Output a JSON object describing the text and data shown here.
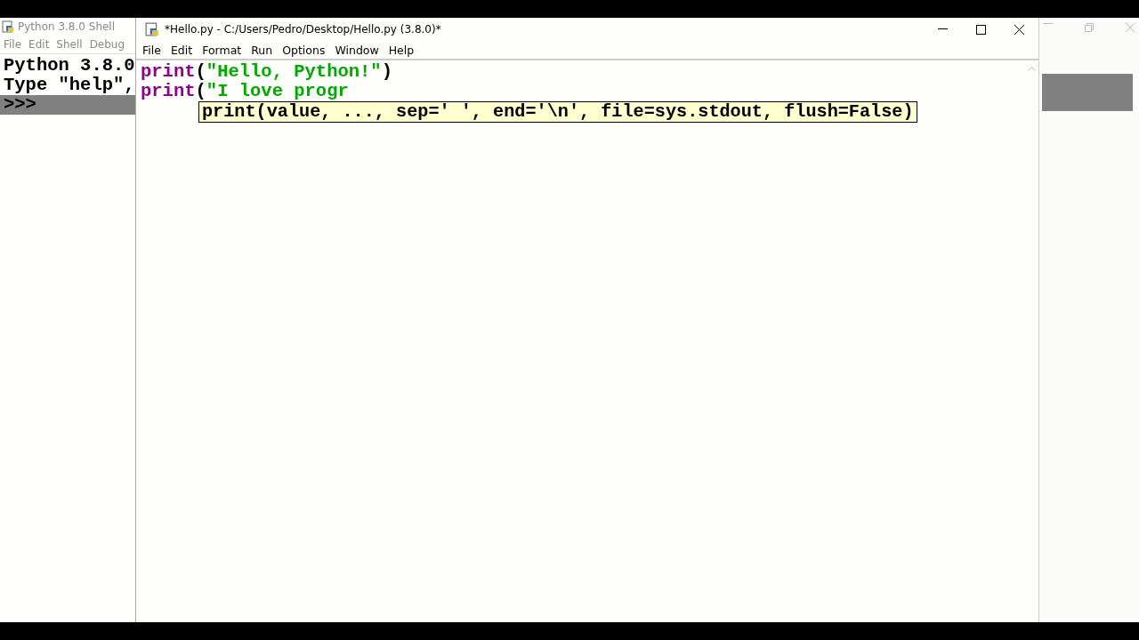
{
  "shell_window": {
    "title": "Python 3.8.0 Shell",
    "menu": [
      "File",
      "Edit",
      "Shell",
      "Debug"
    ],
    "lines": [
      "Python 3.8.0",
      "Type \"help\","
    ],
    "prompt": ">>>"
  },
  "editor_window": {
    "title": "*Hello.py - C:/Users/Pedro/Desktop/Hello.py (3.8.0)*",
    "menu": [
      "File",
      "Edit",
      "Format",
      "Run",
      "Options",
      "Window",
      "Help"
    ],
    "code_lines": [
      [
        {
          "kind": "builtin",
          "text": "print"
        },
        {
          "kind": "plain",
          "text": "("
        },
        {
          "kind": "string",
          "text": "\"Hello, Python!\""
        },
        {
          "kind": "plain",
          "text": ")"
        }
      ],
      [
        {
          "kind": "builtin",
          "text": "print"
        },
        {
          "kind": "plain",
          "text": "("
        },
        {
          "kind": "string",
          "text": "\"I love progr"
        }
      ]
    ],
    "calltip": "print(value, ..., sep=' ', end='\\n', file=sys.stdout, flush=False)"
  }
}
